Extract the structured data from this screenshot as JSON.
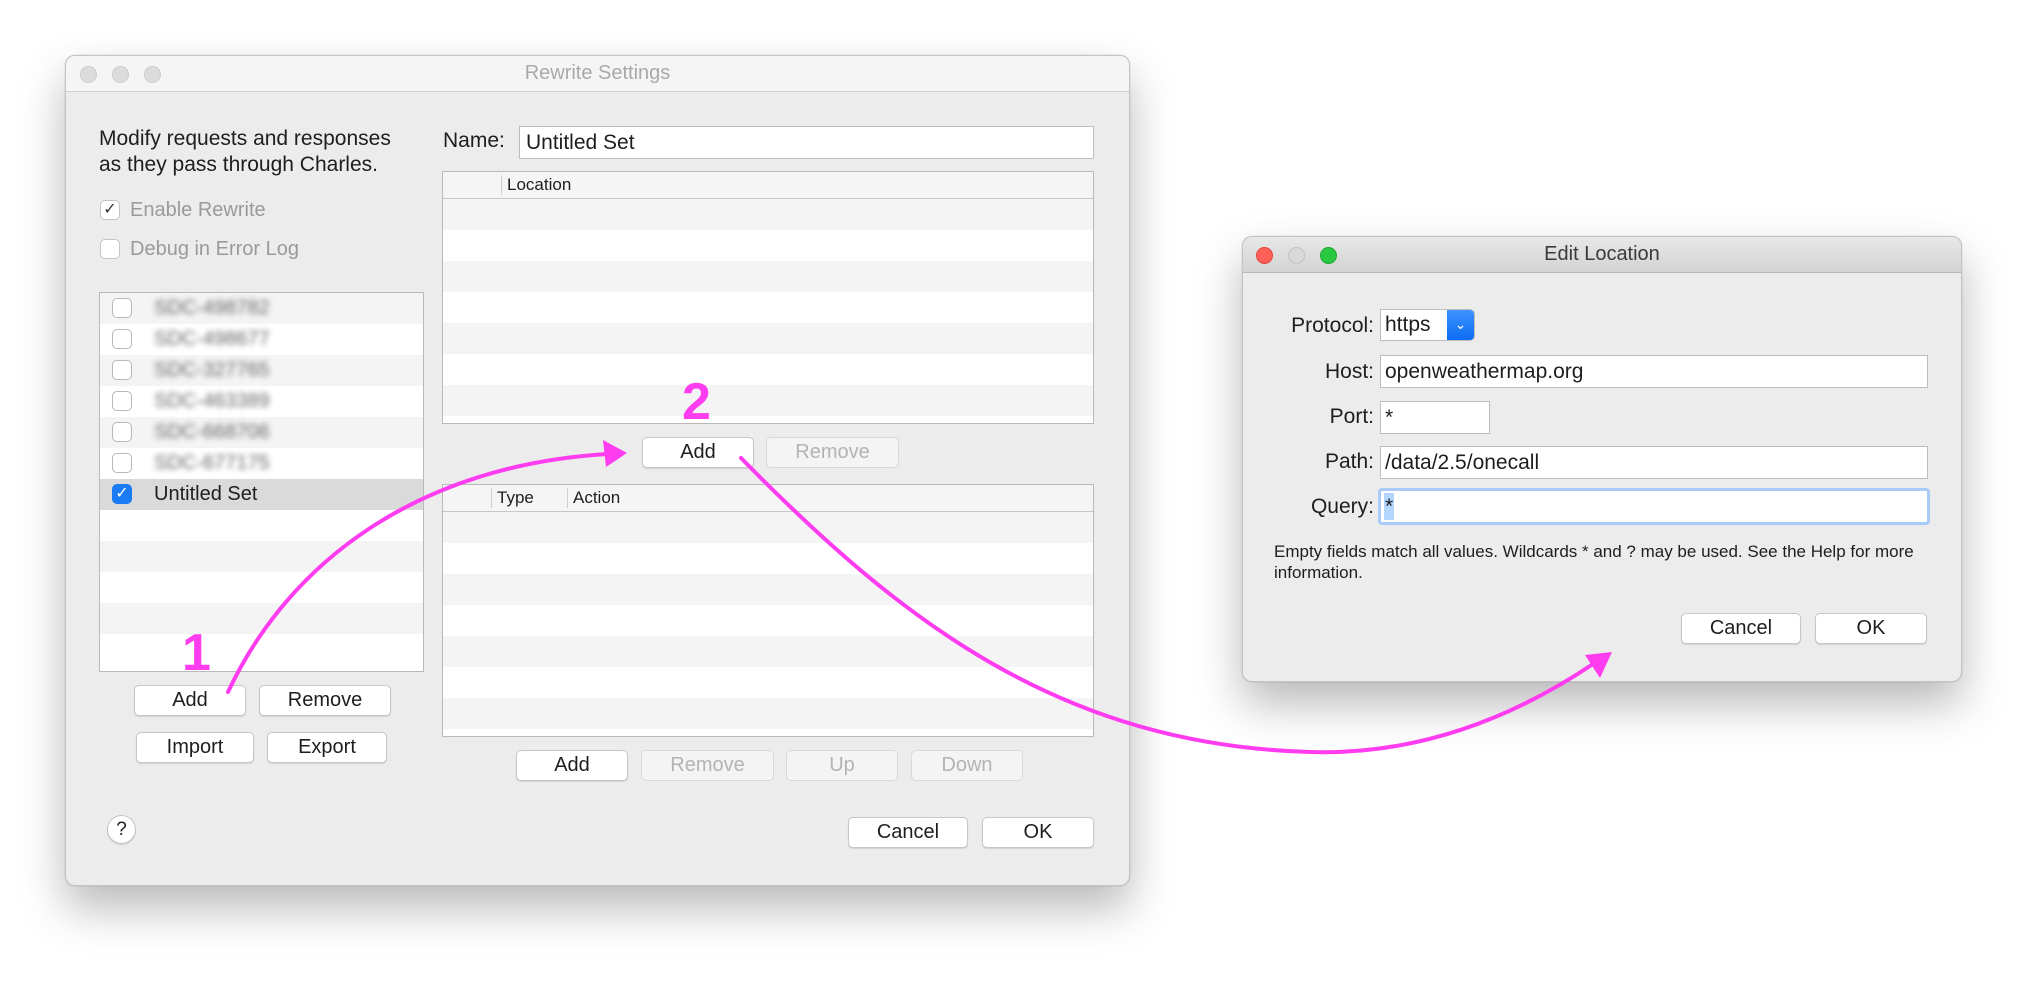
{
  "rewrite_window": {
    "title": "Rewrite Settings",
    "description_line1": "Modify requests and responses",
    "description_line2": "as they pass through Charles.",
    "enable_rewrite": {
      "label": "Enable Rewrite",
      "checked": true,
      "check_glyph": "✓"
    },
    "debug_log": {
      "label": "Debug in Error Log",
      "checked": false
    },
    "sets": [
      {
        "name": "SDC-498782",
        "checked": false,
        "redacted": true
      },
      {
        "name": "SDC-498677",
        "checked": false,
        "redacted": true
      },
      {
        "name": "SDC-327765",
        "checked": false,
        "redacted": true
      },
      {
        "name": "SDC-463389",
        "checked": false,
        "redacted": true
      },
      {
        "name": "SDC-668706",
        "checked": false,
        "redacted": true
      },
      {
        "name": "SDC-677175",
        "checked": false,
        "redacted": true
      },
      {
        "name": "Untitled Set",
        "checked": true,
        "selected": true,
        "check_glyph": "✓"
      }
    ],
    "set_buttons": {
      "add": "Add",
      "remove": "Remove",
      "import": "Import",
      "export": "Export"
    },
    "help_button": "?",
    "name_label": "Name:",
    "name_value": "Untitled Set",
    "locations_table": {
      "columns": [
        "Location"
      ],
      "rows": []
    },
    "location_buttons": {
      "add": "Add",
      "remove": "Remove"
    },
    "rules_table": {
      "columns": [
        "Type",
        "Action"
      ],
      "rows": []
    },
    "rule_buttons": {
      "add": "Add",
      "remove": "Remove",
      "up": "Up",
      "down": "Down"
    },
    "cancel": "Cancel",
    "ok": "OK"
  },
  "edit_location_window": {
    "title": "Edit Location",
    "protocol_label": "Protocol:",
    "protocol_value": "https",
    "host_label": "Host:",
    "host_value": "openweathermap.org",
    "port_label": "Port:",
    "port_value": "*",
    "path_label": "Path:",
    "path_value": "/data/2.5/onecall",
    "query_label": "Query:",
    "query_value": "*",
    "help_text": "Empty fields match all values. Wildcards * and ? may be used. See the Help for more information.",
    "cancel": "Cancel",
    "ok": "OK"
  },
  "annotations": {
    "step1": "1",
    "step2": "2",
    "color": "#ff3cf0"
  },
  "colors": {
    "accent_blue": "#1a7bf5",
    "close": "#fe5f57",
    "minimize_inactive": "#d9d9d9",
    "zoom": "#28c840"
  }
}
